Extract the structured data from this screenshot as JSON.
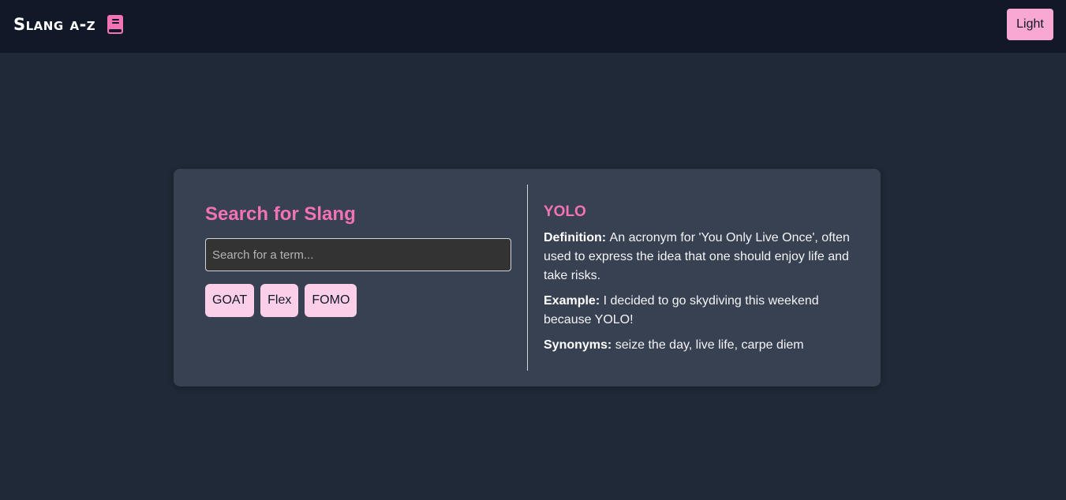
{
  "header": {
    "brand_title": "Slang α-z",
    "brand_icon": "book-icon",
    "theme_toggle_label": "Light",
    "accent_color": "#f472b6"
  },
  "search": {
    "title": "Search for Slang",
    "placeholder": "Search for a term...",
    "value": "",
    "suggestions": [
      "GOAT",
      "Flex",
      "FOMO"
    ]
  },
  "result": {
    "term": "YOLO",
    "definition_label": "Definition:",
    "definition": "An acronym for 'You Only Live Once', often used to express the idea that one should enjoy life and take risks.",
    "example_label": "Example:",
    "example": "I decided to go skydiving this weekend because YOLO!",
    "synonyms_label": "Synonyms:",
    "synonyms": "seize the day, live life, carpe diem"
  }
}
